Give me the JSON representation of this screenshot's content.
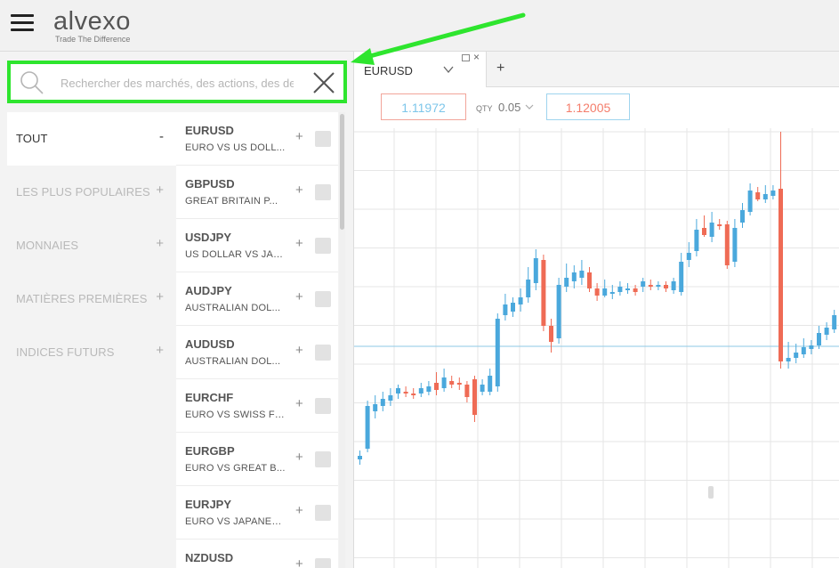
{
  "header": {
    "menu_icon": "hamburger-menu-icon",
    "logo_text": "alvexo",
    "logo_tagline": "Trade The Difference"
  },
  "search": {
    "placeholder": "Rechercher des marchés, des actions, des devises",
    "value": "",
    "search_icon": "search-icon",
    "clear_icon": "close-icon",
    "highlight_color": "#2ee52e"
  },
  "categories": [
    {
      "label": "TOUT",
      "toggle": "-",
      "active": true
    },
    {
      "label": "LES PLUS POPULAIRES",
      "toggle": "+",
      "active": false
    },
    {
      "label": "MONNAIES",
      "toggle": "+",
      "active": false
    },
    {
      "label": "MATIÈRES PREMIÈRES",
      "toggle": "+",
      "active": false
    },
    {
      "label": "INDICES FUTURS",
      "toggle": "+",
      "active": false
    }
  ],
  "instruments": [
    {
      "symbol": "EURUSD",
      "desc": "EURO VS US DOLL...",
      "add": "+"
    },
    {
      "symbol": "GBPUSD",
      "desc": "GREAT BRITAIN P...",
      "add": "+"
    },
    {
      "symbol": "USDJPY",
      "desc": "US DOLLAR VS JAP...",
      "add": "+"
    },
    {
      "symbol": "AUDJPY",
      "desc": "AUSTRALIAN DOL...",
      "add": "+"
    },
    {
      "symbol": "AUDUSD",
      "desc": "AUSTRALIAN DOL...",
      "add": "+"
    },
    {
      "symbol": "EURCHF",
      "desc": "EURO VS SWISS FR...",
      "add": "+"
    },
    {
      "symbol": "EURGBP",
      "desc": "EURO VS GREAT B...",
      "add": "+"
    },
    {
      "symbol": "EURJPY",
      "desc": "EURO VS JAPANES...",
      "add": "+"
    },
    {
      "symbol": "NZDUSD",
      "desc": "",
      "add": "+"
    }
  ],
  "chart_panel": {
    "tab_label": "EURUSD",
    "tab_close": "×",
    "tab_add": "+",
    "bid": "1.11972",
    "qty_label": "QTY",
    "qty_value": "0.05",
    "ask": "1.12005",
    "bid_border_color": "#f2a59a",
    "ask_border_color": "#9fd4ee",
    "up_color": "#4aa8dc",
    "down_color": "#ef6b55"
  },
  "colors": {
    "annotation_arrow": "#2ee52e"
  }
}
